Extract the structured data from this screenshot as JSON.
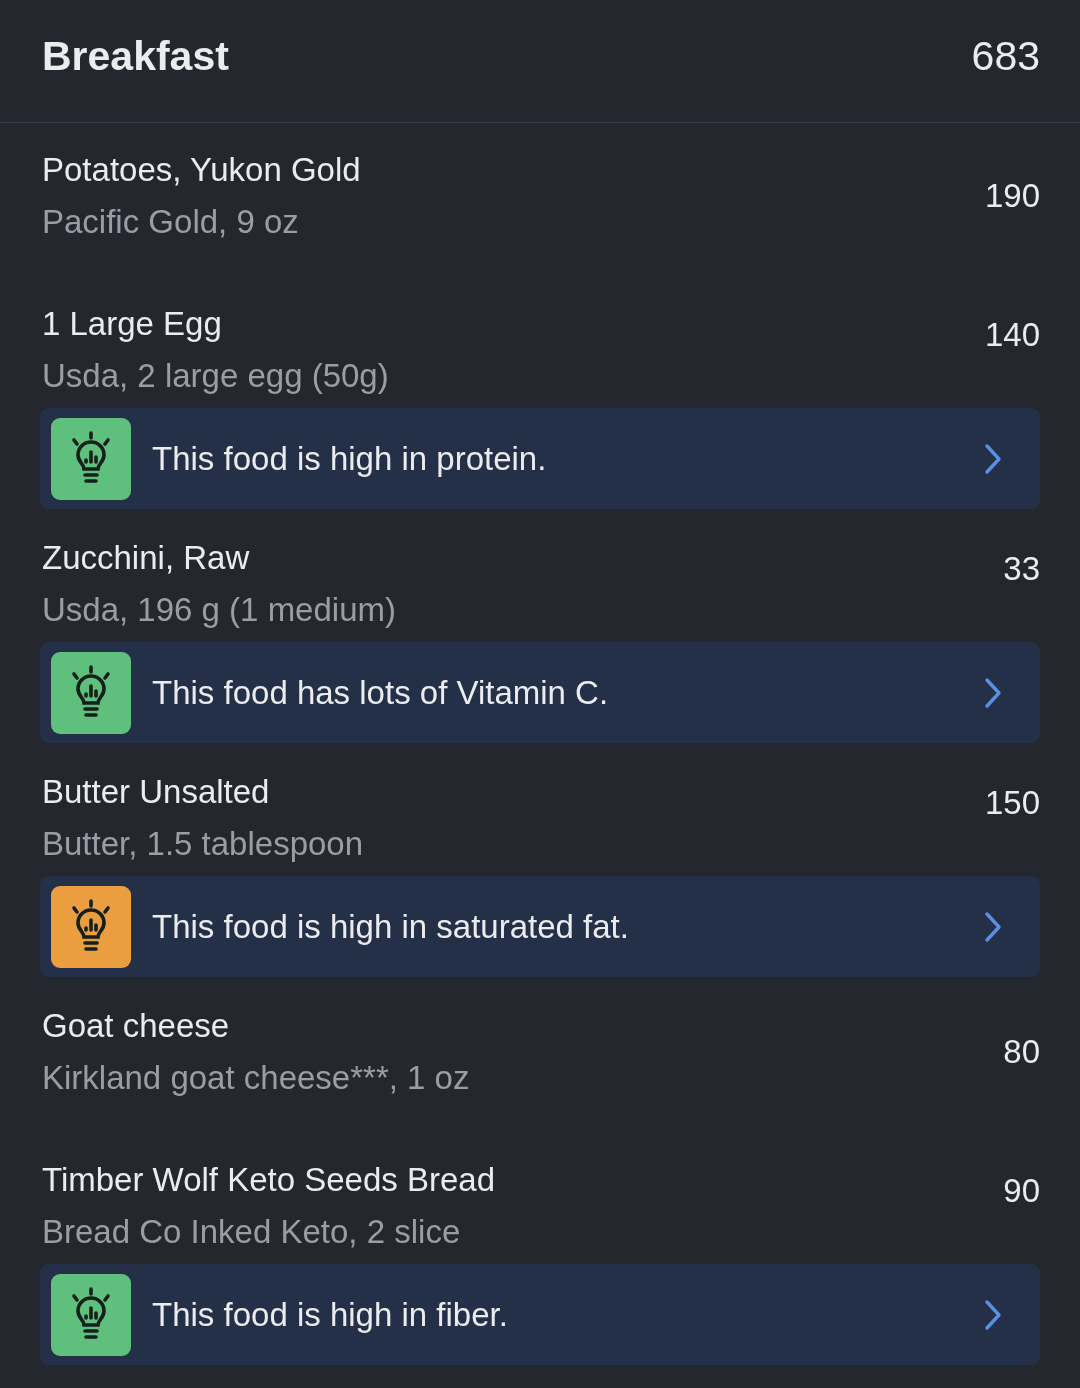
{
  "meal": {
    "title": "Breakfast",
    "calories": "683"
  },
  "foods": [
    {
      "name": "Potatoes, Yukon Gold",
      "detail": "Pacific Gold, 9 oz",
      "calories": "190"
    },
    {
      "name": "1 Large Egg",
      "detail": "Usda, 2 large egg (50g)",
      "calories": "140",
      "tip": {
        "text": "This food is high in protein.",
        "color": "#5ec07c"
      }
    },
    {
      "name": "Zucchini, Raw",
      "detail": "Usda, 196 g (1 medium)",
      "calories": "33",
      "tip": {
        "text": "This food has lots of Vitamin C.",
        "color": "#5ec07c"
      }
    },
    {
      "name": "Butter Unsalted",
      "detail": "Butter, 1.5 tablespoon",
      "calories": "150",
      "tip": {
        "text": "This food is high in saturated fat.",
        "color": "#eb9e3f"
      }
    },
    {
      "name": "Goat cheese",
      "detail": "Kirkland goat cheese***, 1 oz",
      "calories": "80"
    },
    {
      "name": "Timber Wolf Keto Seeds Bread",
      "detail": "Bread Co Inked Keto, 2 slice",
      "calories": "90",
      "tip": {
        "text": "This food is high in fiber.",
        "color": "#5ec07c"
      }
    }
  ]
}
